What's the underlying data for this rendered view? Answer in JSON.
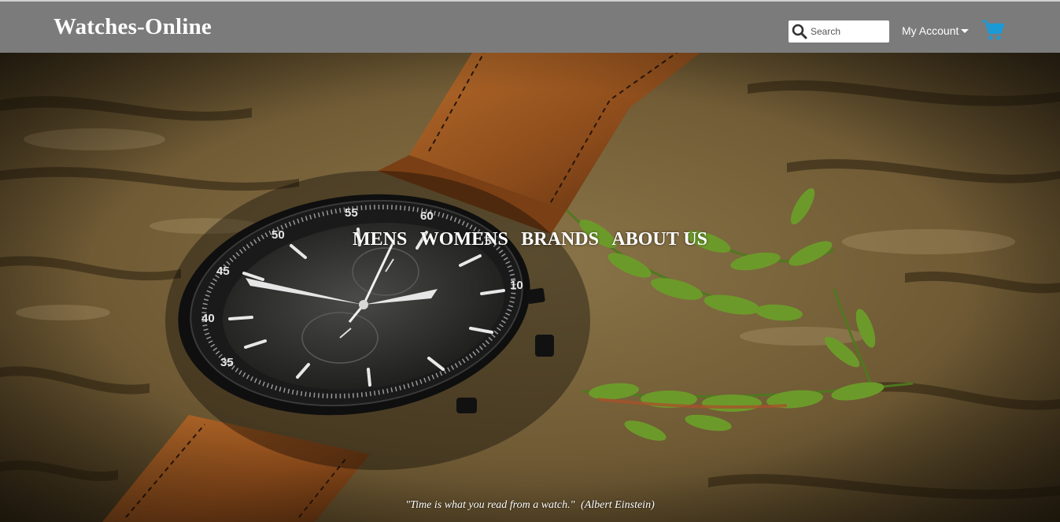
{
  "header": {
    "brand": "Watches-Online",
    "search_placeholder": "Search",
    "account_label": "My Account",
    "icons": {
      "search": "search-icon",
      "account_menu": "caret-down-icon",
      "cart": "shopping-cart-icon"
    },
    "colors": {
      "bar": "#7b7b7b",
      "cart": "#1b9ad6"
    }
  },
  "nav": {
    "items": [
      {
        "label": "MENS"
      },
      {
        "label": "WOMENS"
      },
      {
        "label": "BRANDS"
      },
      {
        "label": "ABOUT US"
      }
    ]
  },
  "hero": {
    "quote": "\"Time is what you read from a watch.\"",
    "author": "(Albert Einstein)",
    "dial_numbers": [
      "55",
      "60",
      "5",
      "10",
      "50",
      "45",
      "40",
      "35"
    ]
  }
}
